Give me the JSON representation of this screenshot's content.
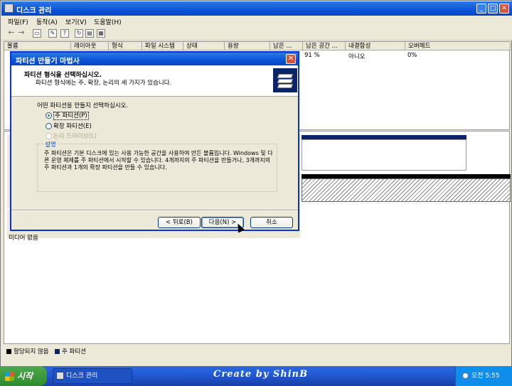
{
  "window": {
    "title": "디스크 관리",
    "controls": {
      "minimize": "_",
      "maximize": "□",
      "close": "✕"
    }
  },
  "menu": [
    "파일(F)",
    "동작(A)",
    "보기(V)",
    "도움말(H)"
  ],
  "toolbar_icons": [
    "back-arrow-icon",
    "forward-arrow-icon",
    "console-icon",
    "properties-icon",
    "help-icon",
    "refresh-icon",
    "export-icon",
    "settings-icon"
  ],
  "list": {
    "columns": [
      "볼륨",
      "레이아웃",
      "형식",
      "파일 시스템",
      "상태",
      "용량",
      "남은 ...",
      "남은 공간 ...",
      "내결함성",
      "오버헤드"
    ],
    "row": {
      "free_pct": "91 %",
      "fault_tolerance": "아니오",
      "overhead": "0%"
    }
  },
  "graph": {
    "media_status": "미디어 없음"
  },
  "legend": [
    {
      "label": "할당되지 않음",
      "color": "#000000"
    },
    {
      "label": "주 파티션",
      "color": "#0A246A"
    }
  ],
  "dialog": {
    "title": "파티션 만들기 마법사",
    "header_title": "파티션 형식을 선택하십시오.",
    "header_subtitle": "파티션 형식에는 주, 확장, 논리의 세 가지가 있습니다.",
    "question": "어떤 파티션을 만들지 선택하십시오.",
    "options": [
      {
        "label": "주 파티션(P)",
        "selected": true,
        "enabled": true
      },
      {
        "label": "확장 파티션(E)",
        "selected": false,
        "enabled": true
      },
      {
        "label": "논리 드라이브(L)",
        "selected": false,
        "enabled": false
      }
    ],
    "description_title": "설명",
    "description_text": "주 파티션은 기본 디스크에 있는 사용 가능한 공간을 사용하여 만든 볼륨입니다. Windows 및 다른 운영 체제를 주 파티션에서 시작할 수 있습니다. 4개까지의 주 파티션을 만들거나, 3개까지의 주 파티션과 1개의 확장 파티션을 만들 수 있습니다.",
    "buttons": {
      "back": "< 뒤로(B)",
      "next": "다음(N) >",
      "cancel": "취소"
    }
  },
  "taskbar": {
    "start_label": "시작",
    "task_label": "디스크 관리",
    "branding": "Create by ShinB",
    "clock": "오전 5:55"
  }
}
